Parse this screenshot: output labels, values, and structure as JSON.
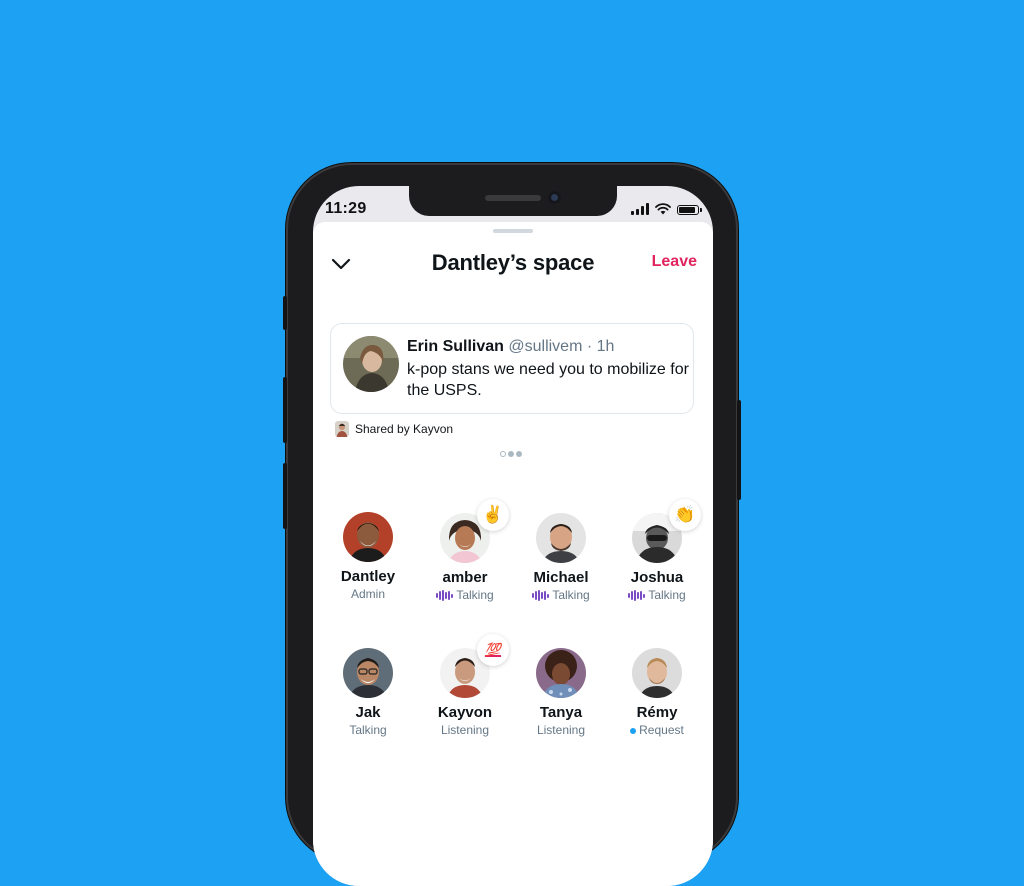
{
  "status_bar": {
    "time": "11:29"
  },
  "space": {
    "title": "Dantley’s space",
    "leave_label": "Leave",
    "collapse_icon": "chevron-down-icon"
  },
  "tweet": {
    "author_name": "Erin Sullivan",
    "author_handle": "@sullivem",
    "separator": "·",
    "time": "1h",
    "text": "k-pop stans we need you to mobilize for the USPS."
  },
  "shared_by": "Shared by Kayvon",
  "pagination": {
    "dots": 3,
    "active": 0
  },
  "participants": [
    {
      "name": "Dantley",
      "status": "Admin",
      "reaction": ""
    },
    {
      "name": "amber",
      "status": "Talking",
      "reaction": "✌️"
    },
    {
      "name": "Michael",
      "status": "Talking",
      "reaction": ""
    },
    {
      "name": "Joshua",
      "status": "Talking",
      "reaction": "👏"
    },
    {
      "name": "Jak",
      "status": "Talking",
      "reaction": ""
    },
    {
      "name": "Kayvon",
      "status": "Listening",
      "reaction": "💯"
    },
    {
      "name": "Tanya",
      "status": "Listening",
      "reaction": ""
    },
    {
      "name": "Rémy",
      "status": "Request",
      "reaction": ""
    }
  ],
  "colors": {
    "background": "#1da1f2",
    "leave": "#e0245e",
    "talking_wave": "#794bc4",
    "request_dot": "#1da1f2"
  }
}
